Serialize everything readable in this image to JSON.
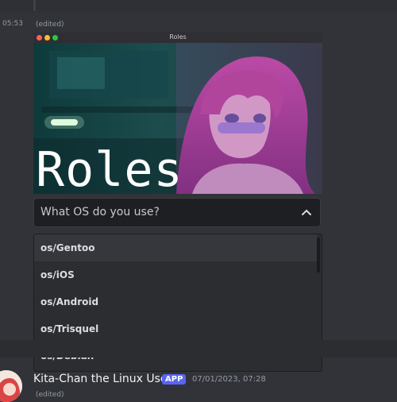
{
  "previous_message": {
    "timestamp": "05:53",
    "edited_label": "(edited)"
  },
  "embed": {
    "window_title": "Roles",
    "banner_text": "Roles",
    "image_icon": "anime-girl-artwork"
  },
  "select_menu": {
    "placeholder": "What OS do you use?",
    "expanded": true,
    "options": [
      {
        "label": "os/Gentoo",
        "highlighted": true
      },
      {
        "label": "os/iOS"
      },
      {
        "label": "os/Android"
      },
      {
        "label": "os/Trisquel"
      },
      {
        "label": "os/Debian"
      }
    ]
  },
  "next_message": {
    "author": "Kita-Chan the Linux User",
    "badge": "APP",
    "timestamp": "07/01/2023, 07:28",
    "edited_label": "(edited)"
  },
  "colors": {
    "background": "#313338",
    "dropdown_bg": "#2b2d31",
    "badge": "#5865f2"
  }
}
